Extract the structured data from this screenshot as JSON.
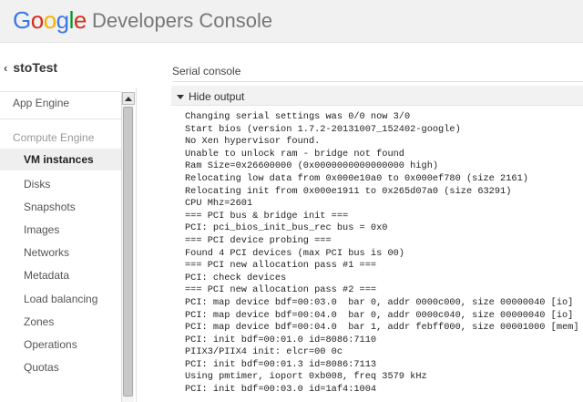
{
  "header": {
    "logo_letters": [
      {
        "char": "G",
        "color": "#3b78e7"
      },
      {
        "char": "o",
        "color": "#d62d20"
      },
      {
        "char": "o",
        "color": "#f5b400"
      },
      {
        "char": "g",
        "color": "#3b78e7"
      },
      {
        "char": "l",
        "color": "#009925"
      },
      {
        "char": "e",
        "color": "#d62d20"
      }
    ],
    "product_name": "Developers Console"
  },
  "project": {
    "back_icon": "chevron-left-icon",
    "name": "stoTest"
  },
  "sidebar": {
    "items": [
      {
        "label": "App Engine"
      },
      {
        "label": "Compute Engine"
      },
      {
        "label": "VM instances"
      },
      {
        "label": "Disks"
      },
      {
        "label": "Snapshots"
      },
      {
        "label": "Images"
      },
      {
        "label": "Networks"
      },
      {
        "label": "Metadata"
      },
      {
        "label": "Load balancing"
      },
      {
        "label": "Zones"
      },
      {
        "label": "Operations"
      },
      {
        "label": "Quotas"
      }
    ]
  },
  "main": {
    "section_title": "Serial console",
    "toggle_label": "Hide output",
    "console_lines": [
      "Changing serial settings was 0/0 now 3/0",
      "Start bios (version 1.7.2-20131007_152402-google)",
      "No Xen hypervisor found.",
      "Unable to unlock ram - bridge not found",
      "Ram Size=0x26600000 (0x0000000000000000 high)",
      "Relocating low data from 0x000e10a0 to 0x000ef780 (size 2161)",
      "Relocating init from 0x000e1911 to 0x265d07a0 (size 63291)",
      "CPU Mhz=2601",
      "=== PCI bus & bridge init ===",
      "PCI: pci_bios_init_bus_rec bus = 0x0",
      "=== PCI device probing ===",
      "Found 4 PCI devices (max PCI bus is 00)",
      "=== PCI new allocation pass #1 ===",
      "PCI: check devices",
      "=== PCI new allocation pass #2 ===",
      "PCI: map device bdf=00:03.0  bar 0, addr 0000c000, size 00000040 [io]",
      "PCI: map device bdf=00:04.0  bar 0, addr 0000c040, size 00000040 [io]",
      "PCI: map device bdf=00:04.0  bar 1, addr febff000, size 00001000 [mem]",
      "PCI: init bdf=00:01.0 id=8086:7110",
      "PIIX3/PIIX4 init: elcr=00 0c",
      "PCI: init bdf=00:01.3 id=8086:7113",
      "Using pmtimer, ioport 0xb008, freq 3579 kHz",
      "PCI: init bdf=00:03.0 id=1af4:1004"
    ]
  }
}
